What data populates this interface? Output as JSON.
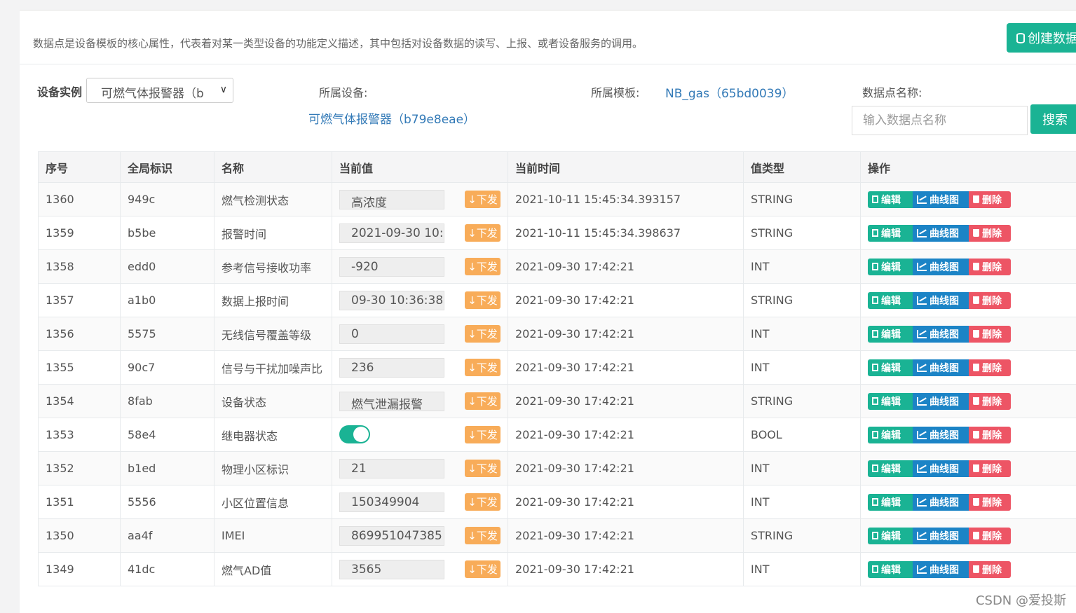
{
  "description": "数据点是设备模板的核心属性，代表着对某一类型设备的功能定义描述，其中包括对设备数据的读写、上报、或者设备服务的调用。",
  "create_button_label": "创建数据",
  "filters": {
    "instance_label": "设备实例",
    "instance_value": "可燃气体报警器（b",
    "device_label": "所属设备:",
    "device_value": "可燃气体报警器（b79e8eae）",
    "template_label": "所属模板:",
    "template_value": "NB_gas（65bd0039）",
    "point_name_label": "数据点名称:",
    "point_name_placeholder": "输入数据点名称",
    "search_label": "搜索"
  },
  "table": {
    "headers": [
      "序号",
      "全局标识",
      "名称",
      "当前值",
      "当前时间",
      "值类型",
      "操作"
    ],
    "send_label": "下发",
    "edit_label": "编辑",
    "chart_label": "曲线图",
    "delete_label": "删除",
    "rows": [
      {
        "seq": "1360",
        "gid": "949c",
        "name": "燃气检测状态",
        "value": "高浓度",
        "kind": "text",
        "time": "2021-10-11 15:45:34.393157",
        "type": "STRING"
      },
      {
        "seq": "1359",
        "gid": "b5be",
        "name": "报警时间",
        "value": "2021-09-30 10:",
        "kind": "text",
        "time": "2021-10-11 15:45:34.398637",
        "type": "STRING"
      },
      {
        "seq": "1358",
        "gid": "edd0",
        "name": "参考信号接收功率",
        "value": "-920",
        "kind": "text",
        "time": "2021-09-30 17:42:21",
        "type": "INT"
      },
      {
        "seq": "1357",
        "gid": "a1b0",
        "name": "数据上报时间",
        "value": "09-30 10:36:38",
        "kind": "text",
        "time": "2021-09-30 17:42:21",
        "type": "STRING"
      },
      {
        "seq": "1356",
        "gid": "5575",
        "name": "无线信号覆盖等级",
        "value": "0",
        "kind": "text",
        "time": "2021-09-30 17:42:21",
        "type": "INT"
      },
      {
        "seq": "1355",
        "gid": "90c7",
        "name": "信号与干扰加噪声比",
        "value": "236",
        "kind": "text",
        "time": "2021-09-30 17:42:21",
        "type": "INT"
      },
      {
        "seq": "1354",
        "gid": "8fab",
        "name": "设备状态",
        "value": "燃气泄漏报警",
        "kind": "text",
        "time": "2021-09-30 17:42:21",
        "type": "STRING"
      },
      {
        "seq": "1353",
        "gid": "58e4",
        "name": "继电器状态",
        "value": "",
        "kind": "toggle",
        "toggle_on": true,
        "time": "2021-09-30 17:42:21",
        "type": "BOOL"
      },
      {
        "seq": "1352",
        "gid": "b1ed",
        "name": "物理小区标识",
        "value": "21",
        "kind": "text",
        "time": "2021-09-30 17:42:21",
        "type": "INT"
      },
      {
        "seq": "1351",
        "gid": "5556",
        "name": "小区位置信息",
        "value": "150349904",
        "kind": "text",
        "time": "2021-09-30 17:42:21",
        "type": "INT"
      },
      {
        "seq": "1350",
        "gid": "aa4f",
        "name": "IMEI",
        "value": "869951047385",
        "kind": "text",
        "time": "2021-09-30 17:42:21",
        "type": "STRING"
      },
      {
        "seq": "1349",
        "gid": "41dc",
        "name": "燃气AD值",
        "value": "3565",
        "kind": "text",
        "time": "2021-09-30 17:42:21",
        "type": "INT"
      }
    ]
  },
  "watermark": "CSDN @爱投斯",
  "colors": {
    "primary": "#1ab394",
    "info": "#1c84c6",
    "danger": "#ed5565",
    "warning": "#f8ac59",
    "link": "#337ab7"
  }
}
